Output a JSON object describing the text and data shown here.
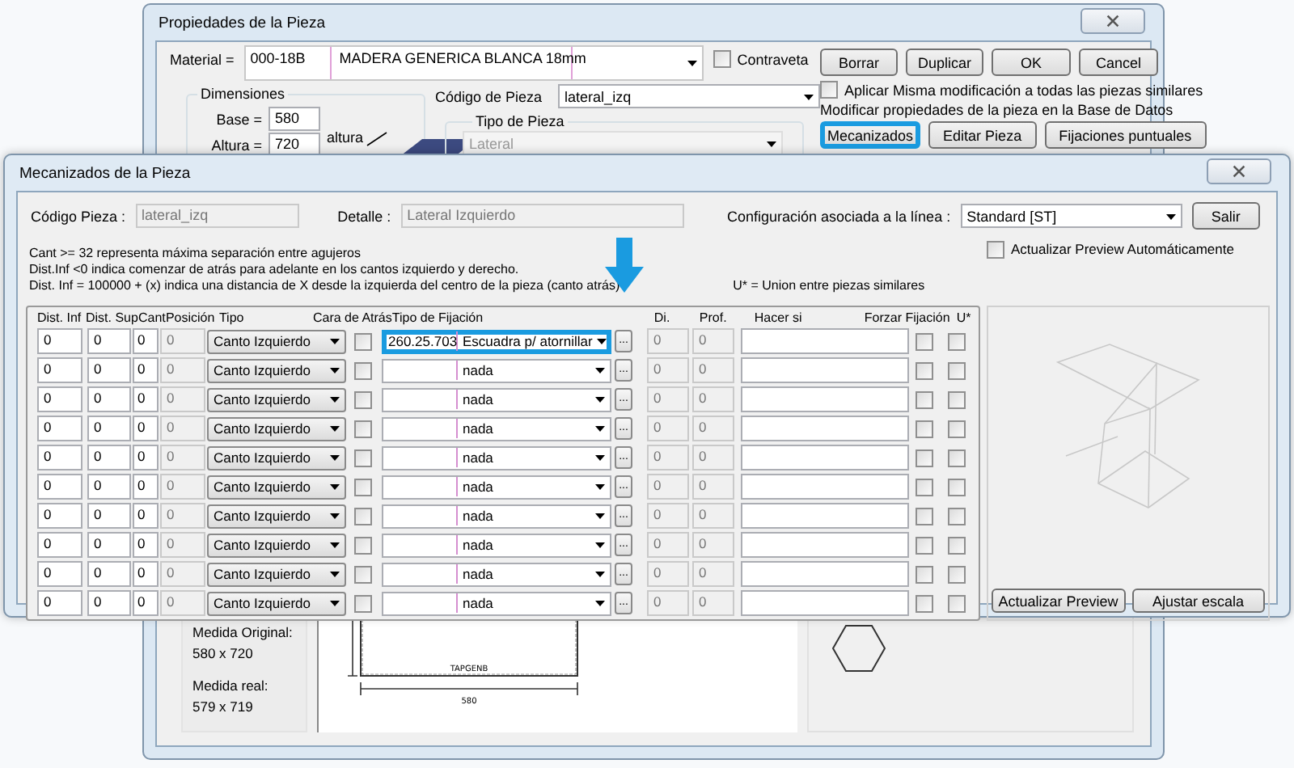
{
  "back_window": {
    "title": "Propiedades de la Pieza",
    "material": {
      "label": "Material =",
      "code": "000-18B",
      "description": "MADERA GENERICA BLANCA 18mm"
    },
    "contraveta": {
      "label": "Contraveta",
      "checked": false
    },
    "buttons": [
      {
        "label": "Borrar"
      },
      {
        "label": "Duplicar"
      },
      {
        "label": "OK"
      },
      {
        "label": "Cancel"
      }
    ],
    "aplicar": {
      "label": "Aplicar Misma modificación a todas las piezas similares",
      "checked": false
    },
    "modificar_text": "Modificar propiedades de la pieza en la Base de Datos",
    "action_buttons": [
      {
        "label": "Mecanizados",
        "highlighted": true
      },
      {
        "label": "Editar Pieza",
        "highlighted": false
      },
      {
        "label": "Fijaciones puntuales",
        "highlighted": false
      }
    ],
    "dimensiones": {
      "title": "Dimensiones",
      "fields": [
        {
          "label": "Base =",
          "value": "580"
        },
        {
          "label": "Altura =",
          "value": "720"
        }
      ],
      "image_label": "altura"
    },
    "codigo_pieza": {
      "label": "Código de Pieza",
      "value": "lateral_izq"
    },
    "tipo_pieza": {
      "title": "Tipo de Pieza",
      "value": "Lateral",
      "disabled": true
    },
    "medidas": [
      {
        "label": "Medida Original:",
        "value": "580 x 720"
      },
      {
        "label": "Medida real:",
        "value": "579 x 719"
      }
    ],
    "drawing": {
      "name_label": "TAPGENB",
      "dimension_label": "580"
    }
  },
  "front_window": {
    "title": "Mecanizados de la Pieza",
    "codigo_pieza": {
      "label": "Código Pieza :",
      "value": "lateral_izq",
      "disabled": true
    },
    "detalle": {
      "label": "Detalle :",
      "value": "Lateral Izquierdo",
      "disabled": true
    },
    "configuracion": {
      "label": "Configuración asociada a la línea :",
      "value": "Standard [ST]"
    },
    "salir": "Salir",
    "notes": [
      "Cant  >= 32 representa máxima separación  entre agujeros",
      "Dist.Inf <0 indica comenzar de atrás para adelante en los cantos izquierdo y derecho.",
      "Dist. Inf = 100000 + (x) indica una distancia de X desde la izquierda del centro de la pieza (canto atrás)"
    ],
    "union_note": "U* = Union entre piezas similares",
    "auto_preview": {
      "label": "Actualizar Preview Automáticamente",
      "checked": false
    },
    "columns": [
      "Dist. Inf",
      "Dist. Sup",
      "Cant",
      "Posición",
      "Tipo",
      "Cara de Atrás",
      "Tipo de Fijación",
      "Di.",
      "Prof.",
      "Hacer si",
      "Forzar Fijación",
      "U*"
    ],
    "rows": [
      {
        "dist_inf": "0",
        "dist_sup": "0",
        "cant": "0",
        "posicion": "0",
        "tipo": "Canto Izquierdo",
        "cara_atras": false,
        "codigo": "260.25.703",
        "fijacion": "Escuadra p/ atornillar",
        "highlighted": true,
        "browse": "...",
        "di": "0",
        "prof": "0",
        "forzar": false,
        "union": false
      },
      {
        "dist_inf": "0",
        "dist_sup": "0",
        "cant": "0",
        "posicion": "0",
        "tipo": "Canto Izquierdo",
        "cara_atras": false,
        "fijacion": "nada",
        "highlighted": false,
        "browse": "...",
        "di": "0",
        "prof": "0",
        "forzar": false,
        "union": false
      },
      {
        "dist_inf": "0",
        "dist_sup": "0",
        "cant": "0",
        "posicion": "0",
        "tipo": "Canto Izquierdo",
        "cara_atras": false,
        "fijacion": "nada",
        "highlighted": false,
        "browse": "...",
        "di": "0",
        "prof": "0",
        "forzar": false,
        "union": false
      },
      {
        "dist_inf": "0",
        "dist_sup": "0",
        "cant": "0",
        "posicion": "0",
        "tipo": "Canto Izquierdo",
        "cara_atras": false,
        "fijacion": "nada",
        "highlighted": false,
        "browse": "...",
        "di": "0",
        "prof": "0",
        "forzar": false,
        "union": false
      },
      {
        "dist_inf": "0",
        "dist_sup": "0",
        "cant": "0",
        "posicion": "0",
        "tipo": "Canto Izquierdo",
        "cara_atras": false,
        "fijacion": "nada",
        "highlighted": false,
        "browse": "...",
        "di": "0",
        "prof": "0",
        "forzar": false,
        "union": false
      },
      {
        "dist_inf": "0",
        "dist_sup": "0",
        "cant": "0",
        "posicion": "0",
        "tipo": "Canto Izquierdo",
        "cara_atras": false,
        "fijacion": "nada",
        "highlighted": false,
        "browse": "...",
        "di": "0",
        "prof": "0",
        "forzar": false,
        "union": false
      },
      {
        "dist_inf": "0",
        "dist_sup": "0",
        "cant": "0",
        "posicion": "0",
        "tipo": "Canto Izquierdo",
        "cara_atras": false,
        "fijacion": "nada",
        "highlighted": false,
        "browse": "...",
        "di": "0",
        "prof": "0",
        "forzar": false,
        "union": false
      },
      {
        "dist_inf": "0",
        "dist_sup": "0",
        "cant": "0",
        "posicion": "0",
        "tipo": "Canto Izquierdo",
        "cara_atras": false,
        "fijacion": "nada",
        "highlighted": false,
        "browse": "...",
        "di": "0",
        "prof": "0",
        "forzar": false,
        "union": false
      },
      {
        "dist_inf": "0",
        "dist_sup": "0",
        "cant": "0",
        "posicion": "0",
        "tipo": "Canto Izquierdo",
        "cara_atras": false,
        "fijacion": "nada",
        "highlighted": false,
        "browse": "...",
        "di": "0",
        "prof": "0",
        "forzar": false,
        "union": false
      },
      {
        "dist_inf": "0",
        "dist_sup": "0",
        "cant": "0",
        "posicion": "0",
        "tipo": "Canto Izquierdo",
        "cara_atras": false,
        "fijacion": "nada",
        "highlighted": false,
        "browse": "...",
        "di": "0",
        "prof": "0",
        "forzar": false,
        "union": false
      }
    ],
    "preview_buttons": [
      "Actualizar Preview",
      "Ajustar escala"
    ]
  }
}
